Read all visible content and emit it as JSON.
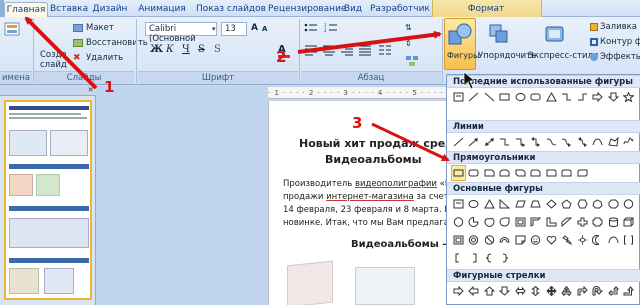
{
  "tabs": [
    {
      "label": "Главная",
      "active": true
    },
    {
      "label": "Вставка"
    },
    {
      "label": "Дизайн"
    },
    {
      "label": "Анимация"
    },
    {
      "label": "Показ слайдов"
    },
    {
      "label": "Рецензирование"
    },
    {
      "label": "Вид"
    },
    {
      "label": "Разработчик"
    },
    {
      "label": "Формат"
    }
  ],
  "ribbon": {
    "slides": {
      "create_label_1": "Созда",
      "create_label_2": "слайд",
      "layout": "Макет",
      "reset": "Восстановить",
      "delete": "Удалить",
      "group_label": "Слайды",
      "group_left": "имена"
    },
    "font": {
      "font_name": "Calibri (Основной",
      "font_size": "13",
      "group_label": "Шрифт"
    },
    "paragraph": {
      "group_label": "Абзац"
    },
    "drawing": {
      "shapes_label": "Фигуры",
      "arrange_label": "Упорядочить",
      "styles_label": "Экспресс-стили",
      "fill": "Заливка фи",
      "outline": "Контур фи",
      "effects": "Эффекты"
    }
  },
  "shapes_menu": {
    "sections": [
      {
        "title": "Последние использованные фигуры"
      },
      {
        "title": "Линии"
      },
      {
        "title": "Прямоугольники"
      },
      {
        "title": "Основные фигуры"
      },
      {
        "title": "Фигурные стрелки"
      }
    ]
  },
  "document": {
    "ruler": "· 1 · · · · 2 · · · · 3 · · · · 4 · · · · 5 · · · · 6",
    "title_1": "Новый хит продаж сред",
    "title_2": "Видеоальбомы",
    "p1_l1_a": "Производитель ",
    "p1_l1_b": "видеополиграфии",
    "p1_l1_c": " «Май",
    "p1_l2_a": "продажи ",
    "p1_l2_b": "интернет-магазина",
    "p1_l2_c": " за счет вид",
    "p1_l3": "14 февраля, 23 февраля и 8 марта. Иде",
    "p1_l4": "новинке. Итак, что мы Вам предлагаем:",
    "subtitle": "Видеоальбомы –"
  },
  "annotations": {
    "n1": "1",
    "n2": "2",
    "n3": "3"
  },
  "colors": {
    "arrow": "#d81212",
    "accent": "#f5c64a"
  }
}
